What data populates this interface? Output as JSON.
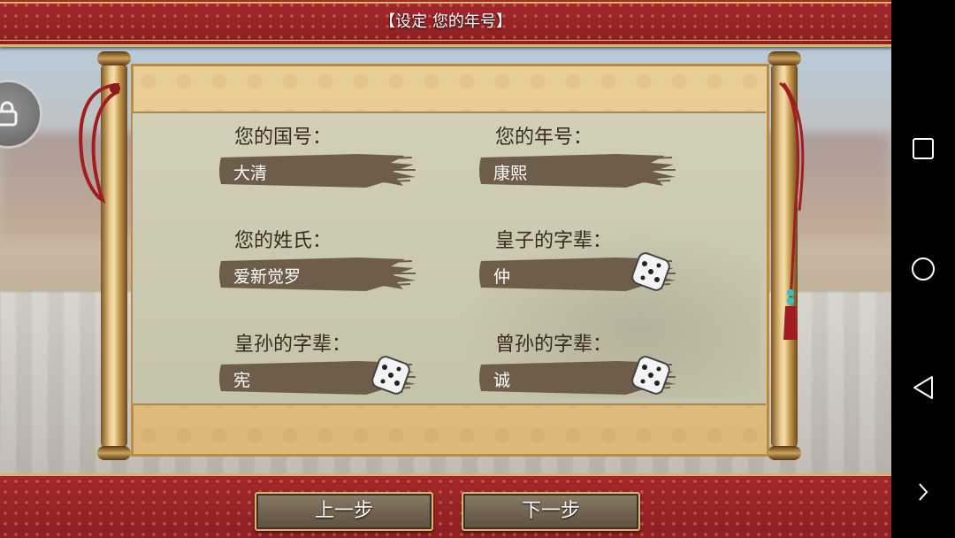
{
  "title": "【设定 您的年号】",
  "fields": [
    {
      "label": "您的国号：",
      "value": "大清",
      "dice": false
    },
    {
      "label": "您的年号：",
      "value": "康熙",
      "dice": false
    },
    {
      "label": "您的姓氏：",
      "value": "爱新觉罗",
      "dice": false
    },
    {
      "label": "皇子的字辈：",
      "value": "仲",
      "dice": true
    },
    {
      "label": "皇孙的字辈：",
      "value": "宪",
      "dice": true
    },
    {
      "label": "曾孙的字辈：",
      "value": "诚",
      "dice": true
    }
  ],
  "buttons": {
    "prev": "上一步",
    "next": "下一步"
  },
  "icons": {
    "lock": "lock-icon",
    "dice": "dice-icon",
    "recent": "square-icon",
    "home": "circle-icon",
    "back": "triangle-back-icon",
    "expand": "chevron-right-icon"
  },
  "colors": {
    "banner": "#9a2427",
    "gold": "#d8b36a",
    "paper": "#e3c385",
    "panel": "#cecbb3",
    "ink": "#6f5d4c"
  }
}
